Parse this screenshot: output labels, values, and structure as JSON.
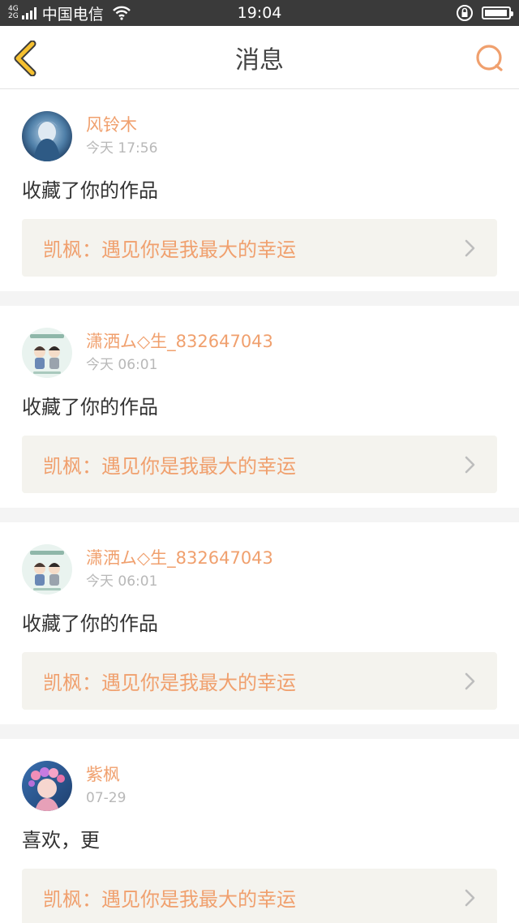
{
  "status_bar": {
    "net_top": "4G",
    "net_bottom": "2G",
    "carrier": "中国电信",
    "time": "19:04",
    "battery_level": 0.95
  },
  "header": {
    "title": "消息"
  },
  "messages": [
    {
      "user": "风铃木",
      "time": "今天 17:56",
      "action": "收藏了你的作品",
      "work": "凯枫：遇见你是我最大的幸运"
    },
    {
      "user": "潇洒ム◇生_832647043",
      "time": "今天 06:01",
      "action": "收藏了你的作品",
      "work": "凯枫：遇见你是我最大的幸运"
    },
    {
      "user": "潇洒ム◇生_832647043",
      "time": "今天 06:01",
      "action": "收藏了你的作品",
      "work": "凯枫：遇见你是我最大的幸运"
    },
    {
      "user": "紫枫",
      "time": "07-29",
      "action": "喜欢，更",
      "work": "凯枫：遇见你是我最大的幸运"
    }
  ],
  "colors": {
    "accent": "#f0a06e",
    "back_arrow": "#f5c030",
    "status_bar": "#3a3a3a"
  }
}
